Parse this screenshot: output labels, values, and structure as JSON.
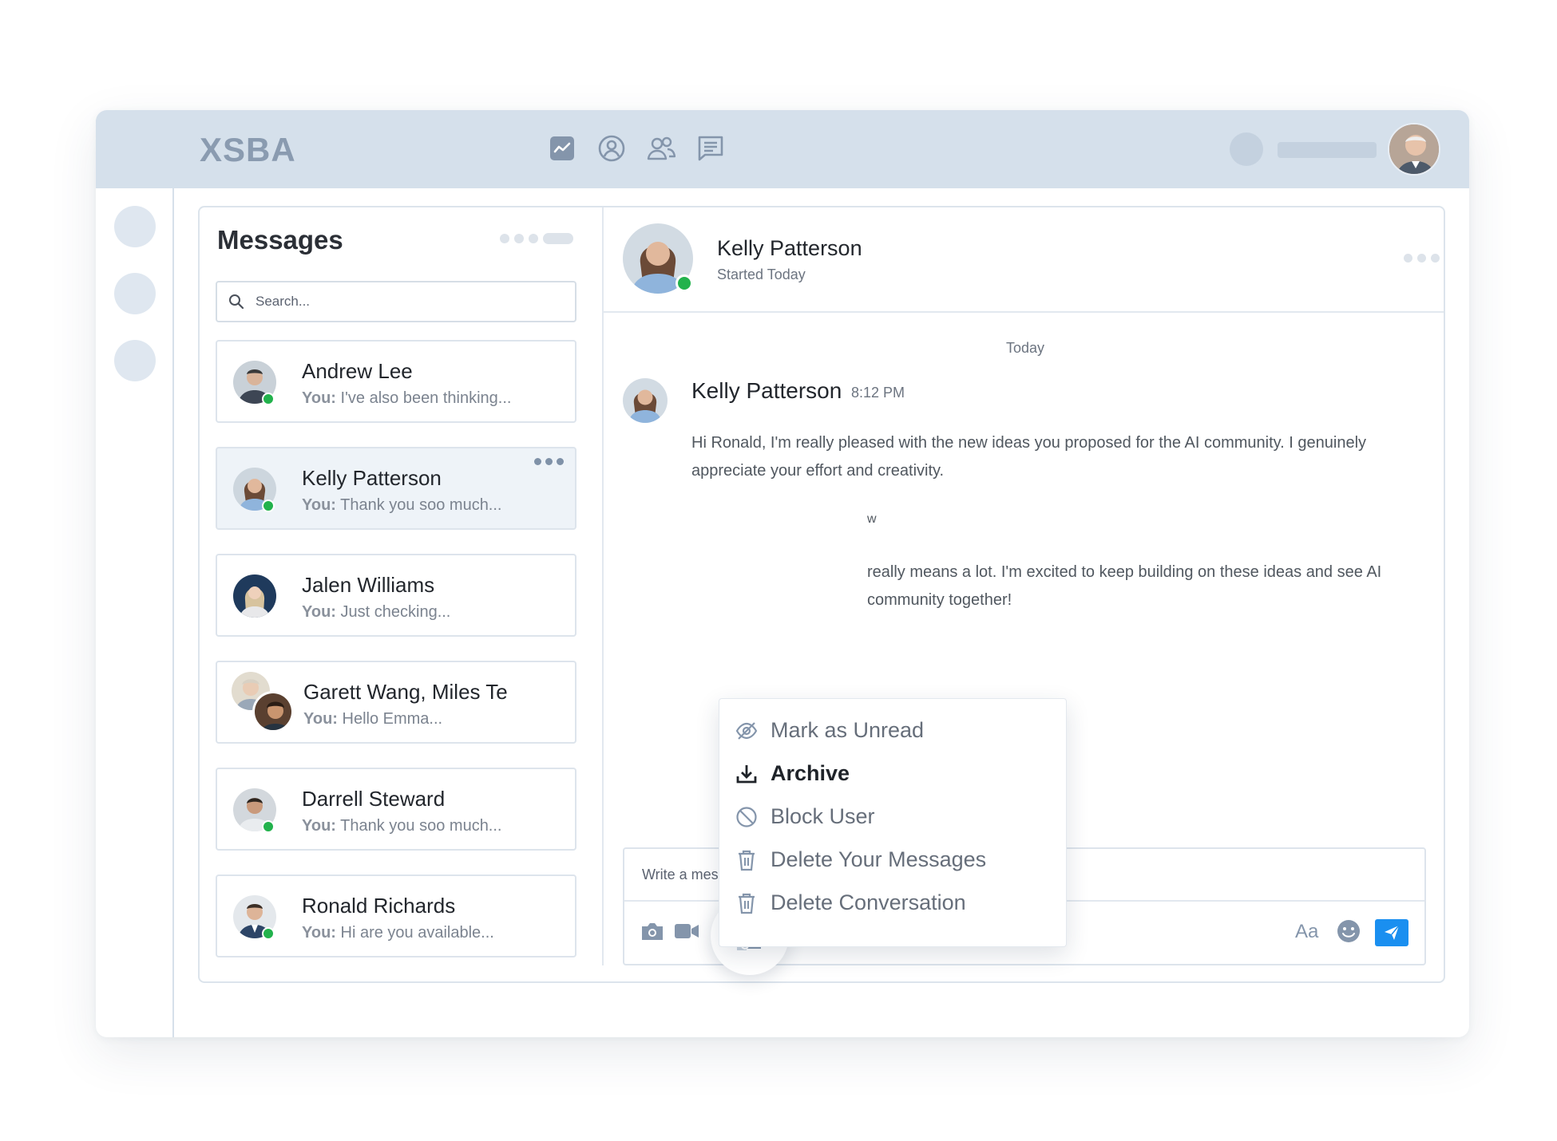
{
  "app": {
    "logo": "XSBA"
  },
  "nav": {
    "icons": [
      "analytics-icon",
      "account-icon",
      "people-icon",
      "chat-icon"
    ]
  },
  "messages": {
    "title": "Messages",
    "search_placeholder": "Search...",
    "you_label": "You:",
    "conversations": [
      {
        "name": "Andrew Lee",
        "preview": "I've also been thinking...",
        "online": true
      },
      {
        "name": "Kelly Patterson",
        "preview": "Thank you soo much...",
        "online": true,
        "active": true
      },
      {
        "name": "Jalen Williams",
        "preview": "Just checking...",
        "online": false
      },
      {
        "name": "Garett Wang, Miles Te",
        "preview": "Hello Emma...",
        "online": false,
        "group": true
      },
      {
        "name": "Darrell Steward",
        "preview": "Thank you soo much...",
        "online": true
      },
      {
        "name": "Ronald Richards",
        "preview": "Hi are you available...",
        "online": true
      }
    ]
  },
  "chat": {
    "name": "Kelly Patterson",
    "subtitle": "Started Today",
    "day_label": "Today",
    "message": {
      "author": "Kelly Patterson",
      "time": "8:12 PM",
      "text": "Hi Ronald, I'm really pleased with the new ideas you proposed for the AI community. I genuinely appreciate your effort and creativity."
    },
    "partial_fragment": "w",
    "reply_text": "really means a lot. I'm excited to keep building on these ideas and see AI community together!",
    "composer_placeholder": "Write a message...",
    "format_label": "Aa"
  },
  "context_menu": {
    "items": [
      {
        "label": "Mark as Unread",
        "icon": "eye-off-icon"
      },
      {
        "label": "Archive",
        "icon": "download-icon",
        "emphasized": true
      },
      {
        "label": "Block User",
        "icon": "block-icon"
      },
      {
        "label": "Delete Your Messages",
        "icon": "trash-icon"
      },
      {
        "label": "Delete Conversation",
        "icon": "trash-icon"
      }
    ]
  },
  "colors": {
    "topbar": "#d5e0eb",
    "online": "#22b24c",
    "send": "#1a8ff0",
    "icon": "#8495ab"
  }
}
